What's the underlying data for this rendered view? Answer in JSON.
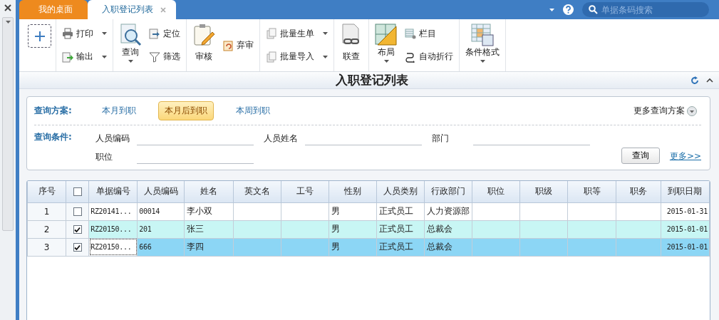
{
  "tabs": [
    {
      "label": "我的桌面",
      "selected": false,
      "closable": false
    },
    {
      "label": "入职登记列表",
      "selected": true,
      "closable": true
    }
  ],
  "search": {
    "placeholder": "单据条码搜索"
  },
  "toolbar": [
    {
      "items": [
        {
          "kind": "add"
        }
      ]
    },
    {
      "items": [
        {
          "kind": "small",
          "label": "打印",
          "dropdown": true
        },
        {
          "kind": "small",
          "label": "输出",
          "dropdown": true
        }
      ]
    },
    {
      "items": [
        {
          "kind": "large",
          "label": "查询",
          "dropdown": true
        },
        {
          "kind": "small",
          "label": "定位",
          "dropdown": false
        },
        {
          "kind": "small",
          "label": "筛选",
          "dropdown": false
        }
      ]
    },
    {
      "items": [
        {
          "kind": "large",
          "label": "审核",
          "dropdown": false
        },
        {
          "kind": "small",
          "label": "弃审",
          "dropdown": false
        }
      ]
    },
    {
      "items": [
        {
          "kind": "small",
          "label": "批量生单",
          "dropdown": true
        },
        {
          "kind": "small",
          "label": "批量导入",
          "dropdown": true
        }
      ]
    },
    {
      "items": [
        {
          "kind": "large",
          "label": "联查",
          "dropdown": false
        }
      ]
    },
    {
      "items": [
        {
          "kind": "large",
          "label": "布局",
          "dropdown": true
        },
        {
          "kind": "small",
          "label": "栏目",
          "dropdown": false
        },
        {
          "kind": "small",
          "label": "自动折行",
          "dropdown": false
        }
      ]
    },
    {
      "items": [
        {
          "kind": "large",
          "label": "条件格式",
          "dropdown": true
        }
      ]
    }
  ],
  "page_title": "入职登记列表",
  "query": {
    "scheme_label": "查询方案:",
    "schemes": [
      {
        "label": "本月到职",
        "selected": false
      },
      {
        "label": "本月后到职",
        "selected": true
      },
      {
        "label": "本周到职",
        "selected": false
      }
    ],
    "more_schemes": "更多查询方案",
    "condition_label": "查询条件:",
    "fields": [
      {
        "label": "人员编码"
      },
      {
        "label": "人员姓名"
      },
      {
        "label": "部门"
      },
      {
        "label": "职位"
      }
    ],
    "search_button": "查询",
    "more_link": "更多>>"
  },
  "table": {
    "header_checkbox": {
      "checked": false
    },
    "columns": [
      "序号",
      "单据编号",
      "人员编码",
      "姓名",
      "英文名",
      "工号",
      "性别",
      "人员类别",
      "行政部门",
      "职位",
      "职级",
      "职等",
      "职务",
      "到职日期"
    ],
    "rows": [
      {
        "checked": false,
        "selected": false,
        "cells": [
          "1",
          "RZ20141...",
          "00014",
          "李小双",
          null,
          null,
          "男",
          "正式员工",
          "人力资源部",
          null,
          null,
          null,
          null,
          "2015-01-31"
        ]
      },
      {
        "checked": true,
        "selected": false,
        "cells": [
          "2",
          "RZ20150...",
          "201",
          "张三",
          null,
          null,
          "男",
          "正式员工",
          "总裁会",
          null,
          null,
          null,
          null,
          "2015-01-01"
        ]
      },
      {
        "checked": true,
        "selected": true,
        "cells": [
          "3",
          "RZ20150...",
          "666",
          "李四",
          null,
          null,
          "男",
          "正式员工",
          "总裁会",
          null,
          null,
          null,
          null,
          "2015-01-01"
        ]
      }
    ]
  }
}
